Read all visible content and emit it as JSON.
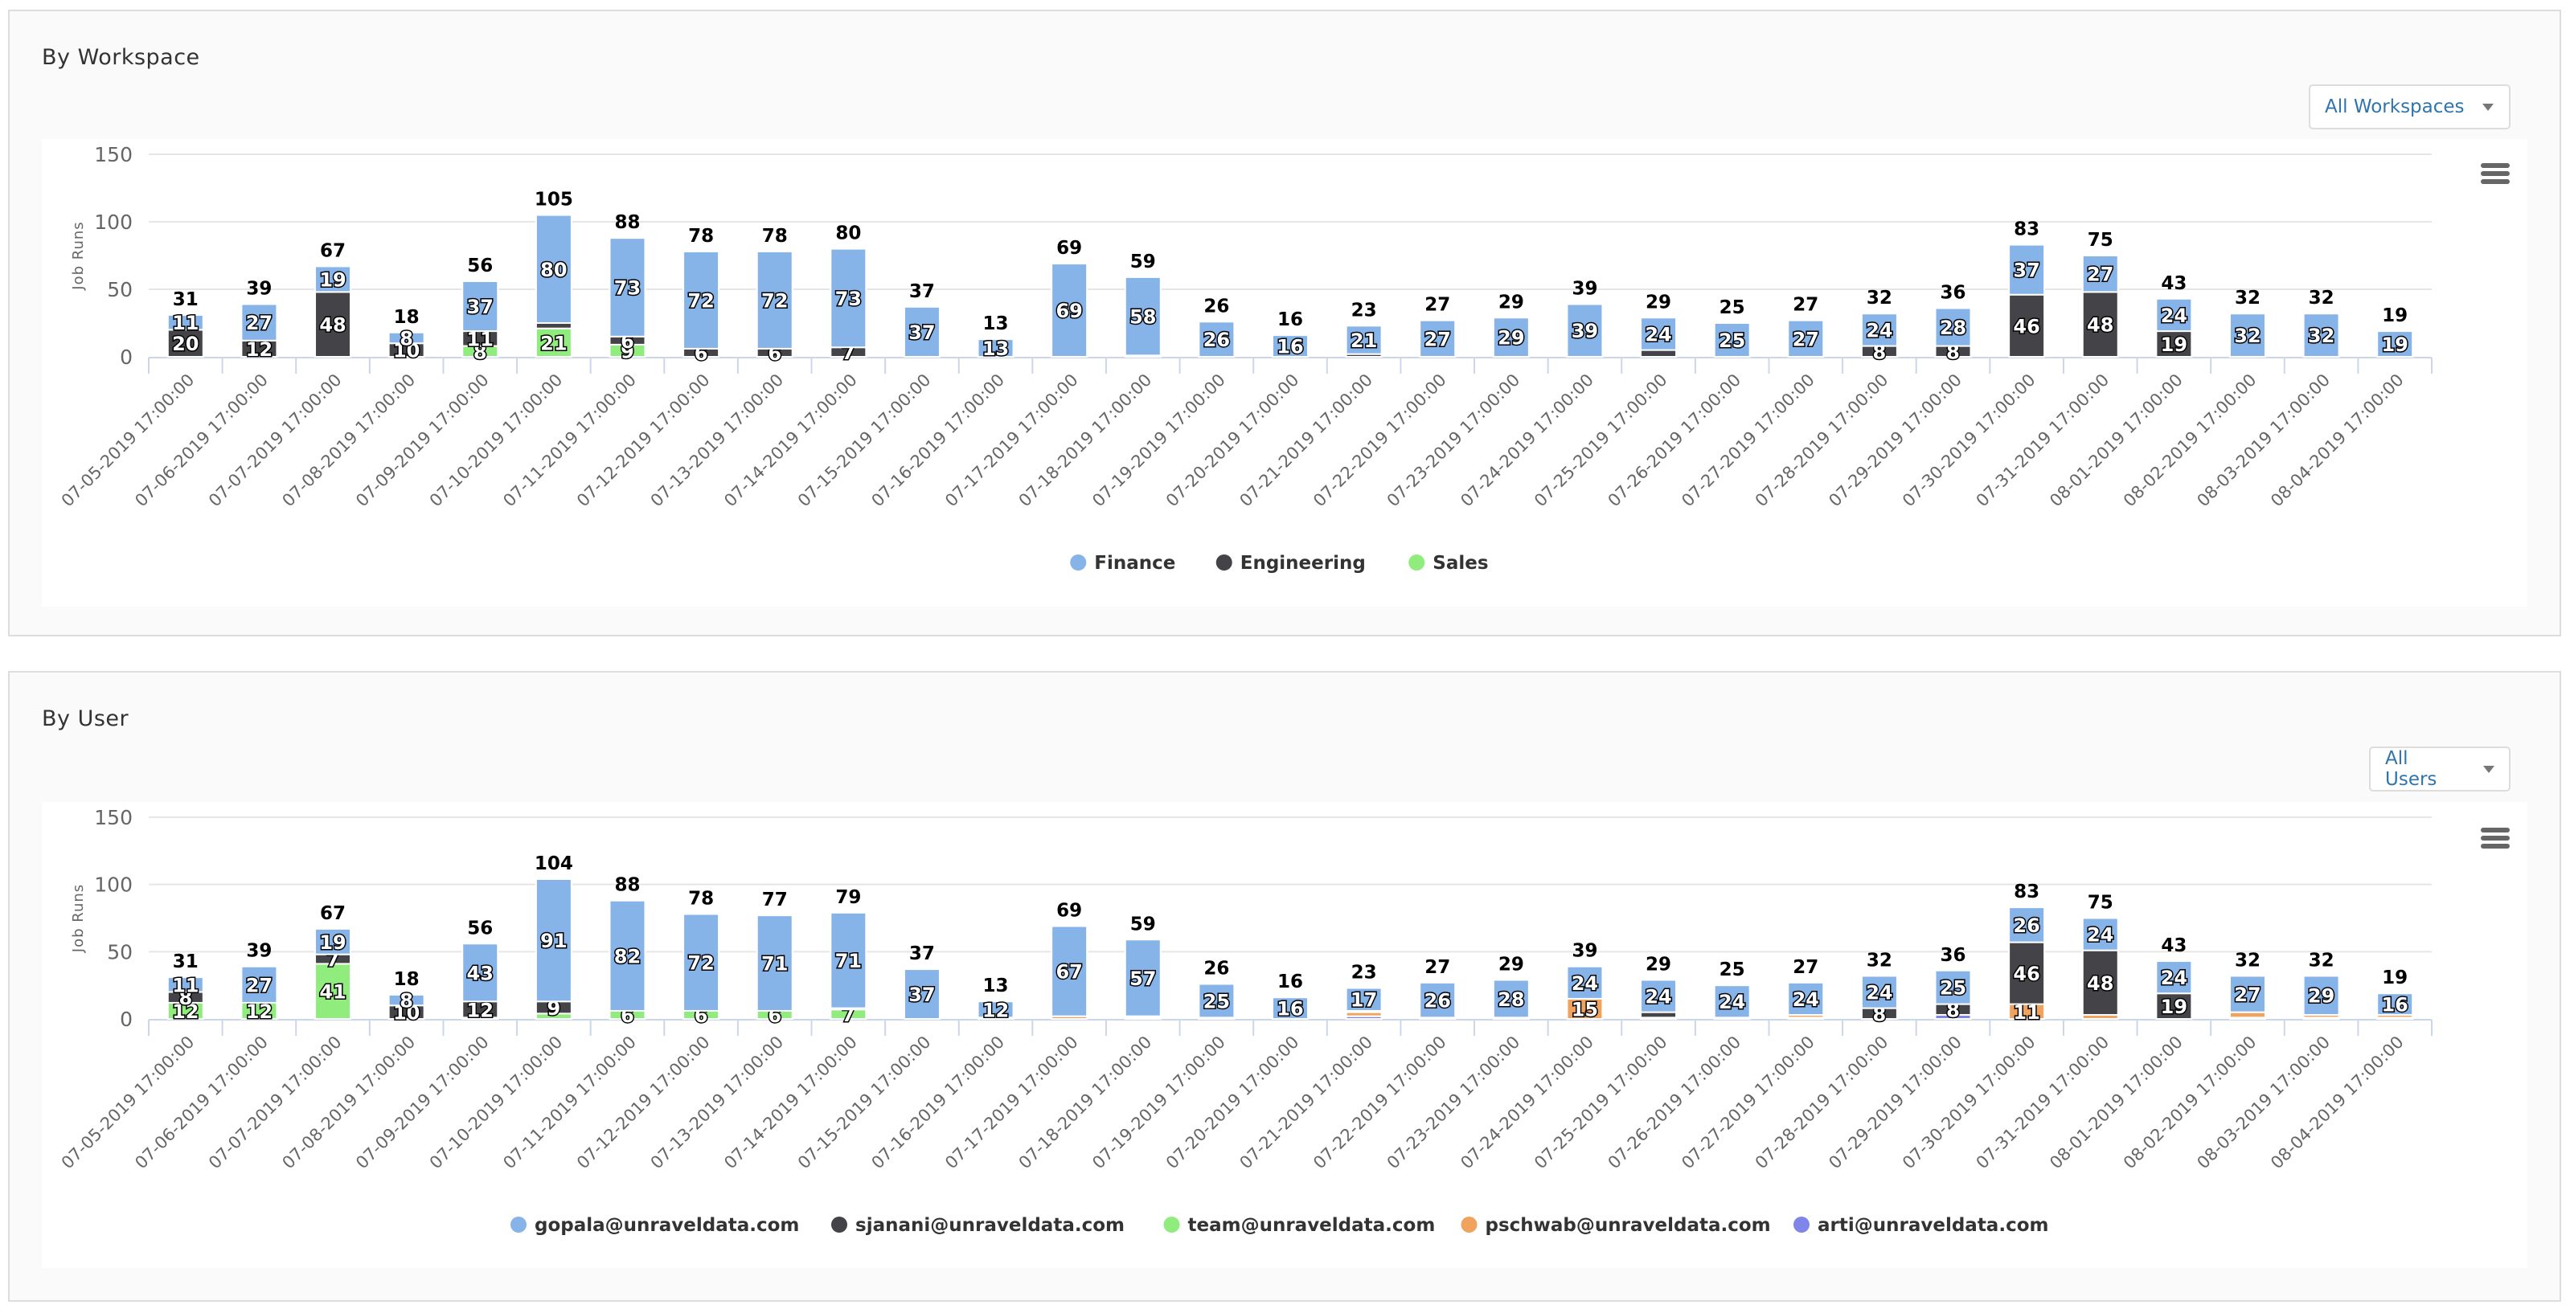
{
  "panels": [
    {
      "title": "By Workspace",
      "dropdown": "All Workspaces"
    },
    {
      "title": "By User",
      "dropdown": "All Users"
    }
  ],
  "colors": {
    "blue": "#86b3e8",
    "dark": "#434348",
    "green": "#90ed7d",
    "orange": "#f0a35f",
    "purple": "#8085e9"
  },
  "chart_data": [
    {
      "type": "bar",
      "stacked": true,
      "ylabel": "Job Runs",
      "ylim": [
        0,
        150
      ],
      "yticks": [
        0,
        50,
        100,
        150
      ],
      "grid": true,
      "legend": "bottom-center",
      "categories": [
        "07-05-2019 17:00:00",
        "07-06-2019 17:00:00",
        "07-07-2019 17:00:00",
        "07-08-2019 17:00:00",
        "07-09-2019 17:00:00",
        "07-10-2019 17:00:00",
        "07-11-2019 17:00:00",
        "07-12-2019 17:00:00",
        "07-13-2019 17:00:00",
        "07-14-2019 17:00:00",
        "07-15-2019 17:00:00",
        "07-16-2019 17:00:00",
        "07-17-2019 17:00:00",
        "07-18-2019 17:00:00",
        "07-19-2019 17:00:00",
        "07-20-2019 17:00:00",
        "07-21-2019 17:00:00",
        "07-22-2019 17:00:00",
        "07-23-2019 17:00:00",
        "07-24-2019 17:00:00",
        "07-25-2019 17:00:00",
        "07-26-2019 17:00:00",
        "07-27-2019 17:00:00",
        "07-28-2019 17:00:00",
        "07-29-2019 17:00:00",
        "07-30-2019 17:00:00",
        "07-31-2019 17:00:00",
        "08-01-2019 17:00:00",
        "08-02-2019 17:00:00",
        "08-03-2019 17:00:00",
        "08-04-2019 17:00:00"
      ],
      "series": [
        {
          "name": "Finance",
          "color": "#86b3e8",
          "values": [
            11,
            27,
            19,
            8,
            37,
            80,
            73,
            72,
            72,
            73,
            37,
            13,
            69,
            58,
            26,
            16,
            21,
            27,
            29,
            39,
            24,
            25,
            27,
            24,
            28,
            37,
            27,
            24,
            32,
            32,
            19
          ]
        },
        {
          "name": "Engineering",
          "color": "#434348",
          "values": [
            20,
            12,
            48,
            10,
            11,
            4,
            6,
            6,
            6,
            7,
            0,
            0,
            0,
            1,
            0,
            0,
            2,
            0,
            0,
            0,
            5,
            0,
            0,
            8,
            8,
            46,
            48,
            19,
            0,
            0,
            0
          ]
        },
        {
          "name": "Sales",
          "color": "#90ed7d",
          "values": [
            0,
            0,
            0,
            0,
            8,
            21,
            9,
            0,
            0,
            0,
            0,
            0,
            0,
            0,
            0,
            0,
            0,
            0,
            0,
            0,
            0,
            0,
            0,
            0,
            0,
            0,
            0,
            0,
            0,
            0,
            0
          ]
        }
      ],
      "totals": [
        31,
        39,
        67,
        18,
        56,
        105,
        88,
        78,
        78,
        80,
        37,
        13,
        69,
        59,
        26,
        16,
        23,
        27,
        29,
        39,
        29,
        25,
        27,
        32,
        36,
        83,
        75,
        43,
        32,
        32,
        19
      ]
    },
    {
      "type": "bar",
      "stacked": true,
      "ylabel": "Job Runs",
      "ylim": [
        0,
        150
      ],
      "yticks": [
        0,
        50,
        100,
        150
      ],
      "grid": true,
      "legend": "bottom-center",
      "categories": [
        "07-05-2019 17:00:00",
        "07-06-2019 17:00:00",
        "07-07-2019 17:00:00",
        "07-08-2019 17:00:00",
        "07-09-2019 17:00:00",
        "07-10-2019 17:00:00",
        "07-11-2019 17:00:00",
        "07-12-2019 17:00:00",
        "07-13-2019 17:00:00",
        "07-14-2019 17:00:00",
        "07-15-2019 17:00:00",
        "07-16-2019 17:00:00",
        "07-17-2019 17:00:00",
        "07-18-2019 17:00:00",
        "07-19-2019 17:00:00",
        "07-20-2019 17:00:00",
        "07-21-2019 17:00:00",
        "07-22-2019 17:00:00",
        "07-23-2019 17:00:00",
        "07-24-2019 17:00:00",
        "07-25-2019 17:00:00",
        "07-26-2019 17:00:00",
        "07-27-2019 17:00:00",
        "07-28-2019 17:00:00",
        "07-29-2019 17:00:00",
        "07-30-2019 17:00:00",
        "07-31-2019 17:00:00",
        "08-01-2019 17:00:00",
        "08-02-2019 17:00:00",
        "08-03-2019 17:00:00",
        "08-04-2019 17:00:00"
      ],
      "series": [
        {
          "name": "gopala@unraveldata.com",
          "color": "#86b3e8",
          "values": [
            11,
            27,
            19,
            8,
            43,
            91,
            82,
            72,
            71,
            71,
            37,
            12,
            67,
            57,
            25,
            16,
            17,
            26,
            28,
            24,
            24,
            24,
            24,
            24,
            25,
            26,
            24,
            24,
            27,
            29,
            16
          ]
        },
        {
          "name": "sjanani@unraveldata.com",
          "color": "#434348",
          "values": [
            8,
            0,
            7,
            10,
            12,
            9,
            0,
            0,
            0,
            1,
            0,
            0,
            0,
            0,
            0,
            0,
            0,
            0,
            0,
            0,
            4,
            0,
            0,
            8,
            8,
            46,
            48,
            19,
            0,
            0,
            0
          ]
        },
        {
          "name": "team@unraveldata.com",
          "color": "#90ed7d",
          "values": [
            12,
            12,
            41,
            0,
            1,
            4,
            6,
            6,
            6,
            7,
            0,
            0,
            0,
            1,
            0,
            0,
            1,
            0,
            0,
            0,
            0,
            0,
            0,
            0,
            0,
            0,
            0,
            0,
            0,
            0,
            0
          ]
        },
        {
          "name": "pschwab@unraveldata.com",
          "color": "#f0a35f",
          "values": [
            0,
            0,
            0,
            0,
            0,
            0,
            0,
            0,
            0,
            0,
            0,
            0,
            2,
            0,
            0,
            0,
            3,
            0,
            0,
            15,
            0,
            0,
            2,
            0,
            0,
            11,
            3,
            0,
            4,
            2,
            2
          ]
        },
        {
          "name": "arti@unraveldata.com",
          "color": "#8085e9",
          "values": [
            0,
            0,
            0,
            0,
            0,
            0,
            0,
            0,
            0,
            0,
            0,
            1,
            0,
            1,
            1,
            0,
            2,
            1,
            1,
            0,
            1,
            1,
            1,
            0,
            3,
            0,
            0,
            0,
            1,
            1,
            1
          ]
        }
      ],
      "totals": [
        31,
        39,
        67,
        18,
        56,
        104,
        88,
        78,
        77,
        79,
        37,
        13,
        69,
        59,
        26,
        16,
        23,
        27,
        29,
        39,
        29,
        25,
        27,
        32,
        36,
        83,
        75,
        43,
        32,
        32,
        19
      ]
    }
  ]
}
